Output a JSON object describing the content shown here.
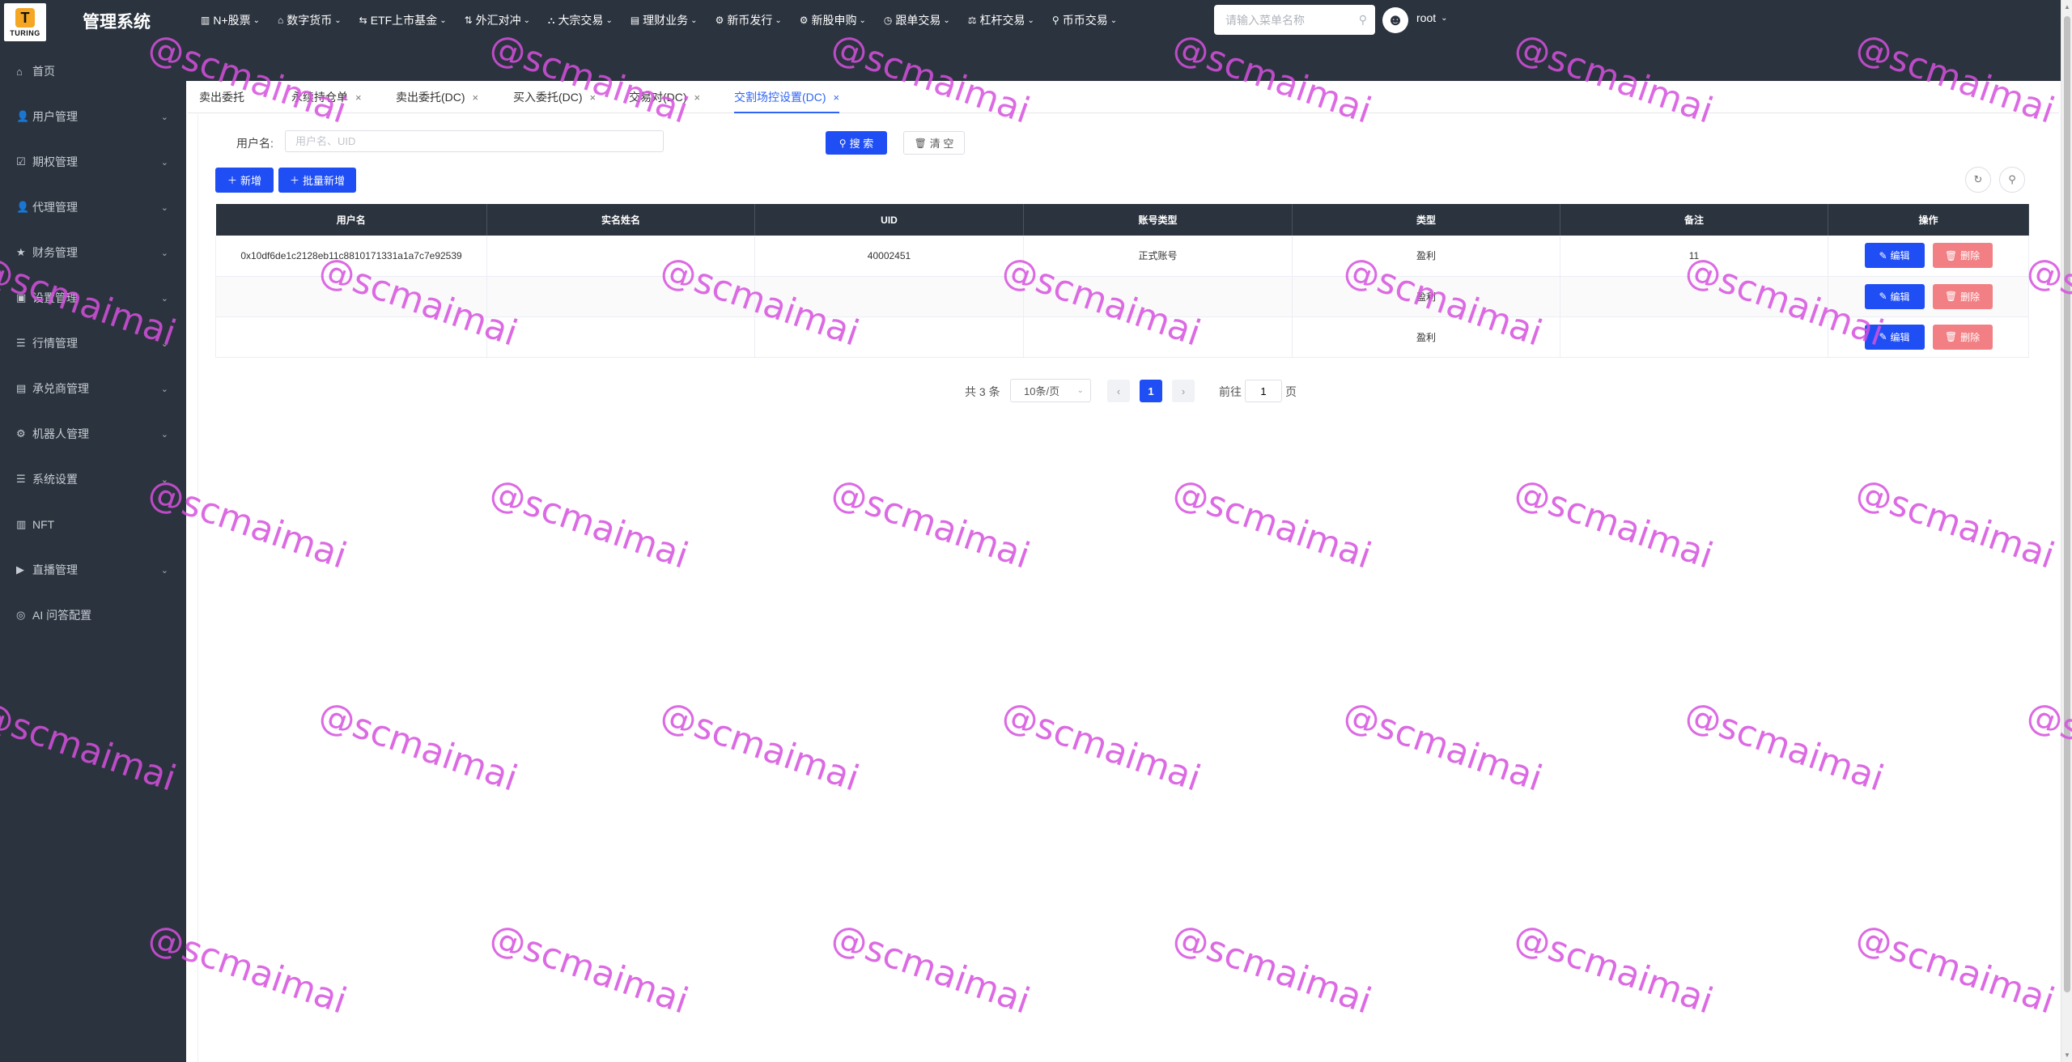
{
  "app": {
    "logo_mark": "T",
    "logo_text": "TURING",
    "title": "管理系统"
  },
  "topnav": [
    {
      "icon": "▥",
      "label": "N+股票"
    },
    {
      "icon": "⌂",
      "label": "数字货币"
    },
    {
      "icon": "⇆",
      "label": "ETF上市基金"
    },
    {
      "icon": "⇅",
      "label": "外汇对冲"
    },
    {
      "icon": "⛬",
      "label": "大宗交易"
    },
    {
      "icon": "▤",
      "label": "理财业务"
    },
    {
      "icon": "⚙",
      "label": "新币发行"
    },
    {
      "icon": "⚙",
      "label": "新股申购"
    },
    {
      "icon": "◷",
      "label": "跟单交易"
    },
    {
      "icon": "⚖",
      "label": "杠杆交易"
    },
    {
      "icon": "⚲",
      "label": "币币交易"
    }
  ],
  "menu_search": {
    "placeholder": "请输入菜单名称"
  },
  "user": {
    "name": "root"
  },
  "sidebar": [
    {
      "icon": "⌂",
      "label": "首页",
      "expandable": false
    },
    {
      "icon": "👤",
      "label": "用户管理",
      "expandable": true
    },
    {
      "icon": "☑",
      "label": "期权管理",
      "expandable": true
    },
    {
      "icon": "👤",
      "label": "代理管理",
      "expandable": true
    },
    {
      "icon": "★",
      "label": "财务管理",
      "expandable": true
    },
    {
      "icon": "▣",
      "label": "设置管理",
      "expandable": true
    },
    {
      "icon": "☰",
      "label": "行情管理",
      "expandable": true
    },
    {
      "icon": "▤",
      "label": "承兑商管理",
      "expandable": true
    },
    {
      "icon": "⚙",
      "label": "机器人管理",
      "expandable": true
    },
    {
      "icon": "☰",
      "label": "系统设置",
      "expandable": true
    },
    {
      "icon": "▥",
      "label": "NFT",
      "expandable": false
    },
    {
      "icon": "▶",
      "label": "直播管理",
      "expandable": true
    },
    {
      "icon": "◎",
      "label": "AI 问答配置",
      "expandable": false
    }
  ],
  "tabs": [
    {
      "label": "卖出委托",
      "closable": false,
      "active": false
    },
    {
      "label": "永续持仓单",
      "closable": true,
      "active": false
    },
    {
      "label": "卖出委托(DC)",
      "closable": true,
      "active": false
    },
    {
      "label": "买入委托(DC)",
      "closable": true,
      "active": false
    },
    {
      "label": "交易对(DC)",
      "closable": true,
      "active": false
    },
    {
      "label": "交割场控设置(DC)",
      "closable": true,
      "active": true
    }
  ],
  "filter": {
    "username_label": "用户名:",
    "username_placeholder": "用户名、UID",
    "search_label": "搜 索",
    "clear_label": "清 空"
  },
  "toolbar": {
    "add_label": "新增",
    "batch_add_label": "批量新增"
  },
  "table": {
    "headers": [
      "用户名",
      "实名姓名",
      "UID",
      "账号类型",
      "类型",
      "备注",
      "操作"
    ],
    "rows": [
      {
        "username": "0x10df6de1c2128eb11c8810171331a1a7c7e92539",
        "realname": "",
        "uid": "40002451",
        "account_type": "正式账号",
        "type": "盈利",
        "remark": "11"
      },
      {
        "username": "",
        "realname": "",
        "uid": "",
        "account_type": "",
        "type": "盈利",
        "remark": ""
      },
      {
        "username": "",
        "realname": "",
        "uid": "",
        "account_type": "",
        "type": "盈利",
        "remark": ""
      }
    ],
    "edit_label": "编辑",
    "delete_label": "删除"
  },
  "pagination": {
    "total": "共 3 条",
    "page_size": "10条/页",
    "current_page": "1",
    "goto_label": "前往",
    "goto_value": "1",
    "page_suffix": "页"
  },
  "watermark": "@scmaimai"
}
